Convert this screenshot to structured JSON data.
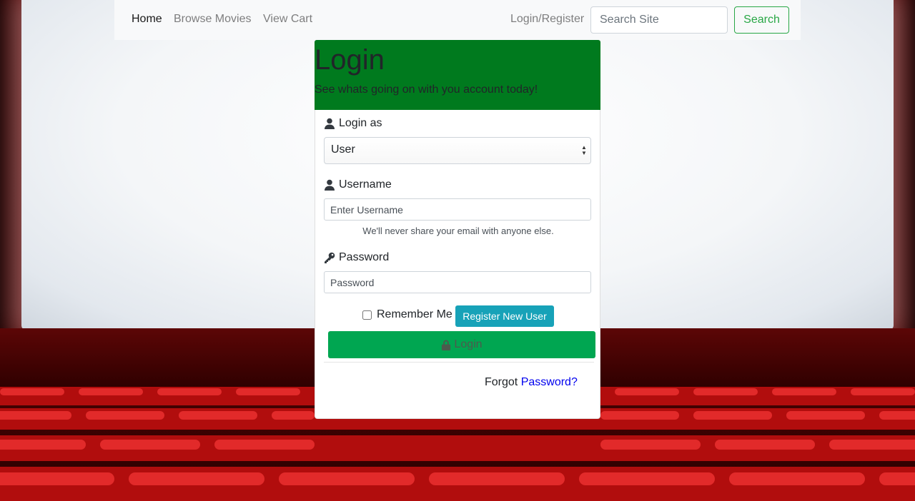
{
  "navbar": {
    "home": "Home",
    "browse_movies": "Browse Movies",
    "view_cart": "View Cart",
    "login_register": "Login/Register",
    "search_placeholder": "Search Site",
    "search_button": "Search"
  },
  "login_header": {
    "title": "Login",
    "subtitle": "See whats going on with you account today!"
  },
  "form": {
    "login_as_label": "Login as",
    "login_as_value": "User",
    "username_label": "Username",
    "username_placeholder": "Enter Username",
    "username_help": "We'll never share your email with anyone else.",
    "password_label": "Password",
    "password_placeholder": "Password",
    "remember_me_label": "Remember Me",
    "remember_me_checked": false,
    "register_button": "Register New User",
    "login_button": "Login",
    "forgot_prefix": "Forgot",
    "forgot_link": "Password?"
  },
  "colors": {
    "header_green": "#007a1e",
    "login_button_green": "#00a651",
    "register_button_teal": "#17a2b8",
    "search_outline_green": "#28a745",
    "link_blue": "#0000ee"
  },
  "icons": {
    "login_as": "user-icon",
    "username": "user-icon",
    "password": "key-icon",
    "login_button": "lock-icon"
  }
}
